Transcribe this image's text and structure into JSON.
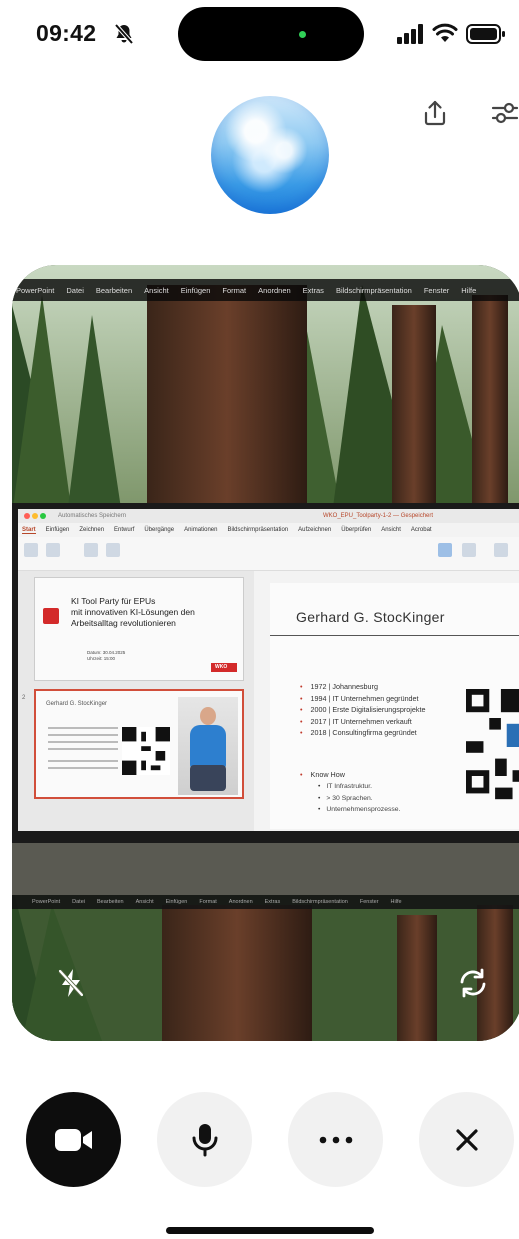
{
  "status_bar": {
    "time": "09:42",
    "icons": [
      "bell-slash-icon",
      "signal-icon",
      "wifi-icon",
      "battery-icon"
    ]
  },
  "top_actions": {
    "share_icon": "share-icon",
    "settings_icon": "sliders-icon"
  },
  "camera": {
    "mac_menu": [
      "PowerPoint",
      "Datei",
      "Bearbeiten",
      "Ansicht",
      "Einfügen",
      "Format",
      "Anordnen",
      "Extras",
      "Bildschirmpräsentation",
      "Fenster",
      "Hilfe"
    ],
    "reflection_menu": [
      "PowerPoint",
      "Datei",
      "Bearbeiten",
      "Ansicht",
      "Einfügen",
      "Format",
      "Anordnen",
      "Extras",
      "Bildschirmpräsentation",
      "Fenster",
      "Hilfe"
    ],
    "ppt": {
      "autosave_label": "Automatisches Speichern",
      "file_title": "WKO_EPU_Toolparty-1-2 — Gespeichert",
      "tabs": [
        "Start",
        "Einfügen",
        "Zeichnen",
        "Entwurf",
        "Übergänge",
        "Animationen",
        "Bildschirmpräsentation",
        "Aufzeichnen",
        "Überprüfen",
        "Ansicht",
        "Acrobat"
      ],
      "slide1": {
        "title_line1": "KI Tool Party für EPUs",
        "title_line2": "mit innovativen KI-Lösungen den",
        "title_line3": "Arbeitsalltag revolutionieren",
        "date_line1": "Datum: 30.04.2025",
        "date_line2": "Uhrzeit: 15:00",
        "badge": "WKO"
      },
      "slide2": {
        "number": "2",
        "name": "Gerhard G. StocKinger"
      },
      "main_slide": {
        "name": "Gerhard G. StocKinger",
        "bullets": [
          "1972 | Johannesburg",
          "1994 | IT Unternehmen gegründet",
          "2000 | Erste Digitalisierungsprojekte",
          "2017 | IT Unternehmen verkauft",
          "2018 | Consultingfirma gegründet"
        ],
        "know_how": "Know How",
        "know_how_items": [
          "IT Infrastruktur.",
          "> 30 Sprachen.",
          "Unternehmensprozesse."
        ]
      }
    },
    "flash_icon": "flash-off-icon",
    "switch_icon": "switch-camera-icon"
  },
  "controls": {
    "video_icon": "video-camera-icon",
    "mic_icon": "microphone-icon",
    "more_icon": "more-dots-icon",
    "close_icon": "close-icon"
  },
  "colors": {
    "island_dot": "#31d158",
    "control_dark": "#0d0d0d",
    "control_light": "#f1f1f1",
    "accent_red": "#d32a2a"
  }
}
